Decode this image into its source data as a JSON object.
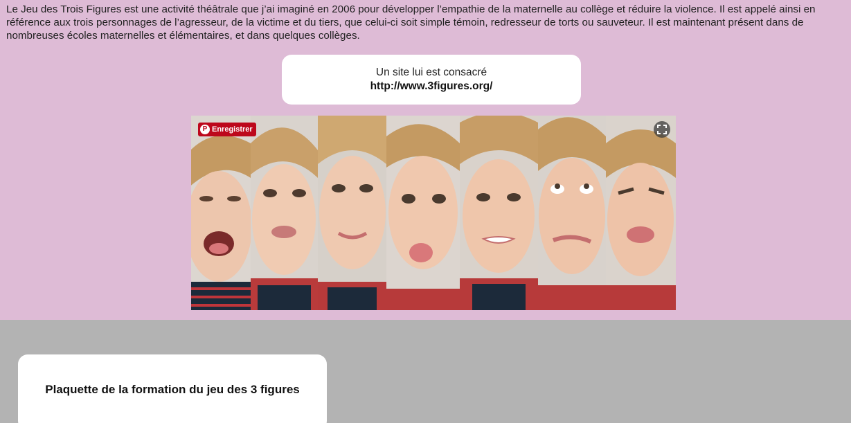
{
  "intro": {
    "text": "Le Jeu des Trois Figures est une activité théâtrale que j’ai imaginé en 2006 pour développer l’empathie de la maternelle au collège et réduire la violence. Il est appelé ainsi en référence aux trois personnages de l’agresseur, de la victime et du tiers, que celui-ci soit simple témoin, redresseur de torts ou sauveteur. Il est maintenant présent dans de nombreuses écoles maternelles et élémentaires, et dans quelques collèges."
  },
  "site_card": {
    "line1": "Un site lui est consacré",
    "link": "http://www.3figures.org/"
  },
  "photo": {
    "pin_label": "Enregistrer",
    "pin_icon": "pinterest-icon",
    "expand_icon": "expand-icon",
    "panel_count": 7
  },
  "bottom_card": {
    "title": "Plaquette de la formation du jeu des 3 figures"
  },
  "colors": {
    "top_background": "#debbd6",
    "page_background": "#b3b3b3",
    "pinterest_red": "#bd081c"
  }
}
